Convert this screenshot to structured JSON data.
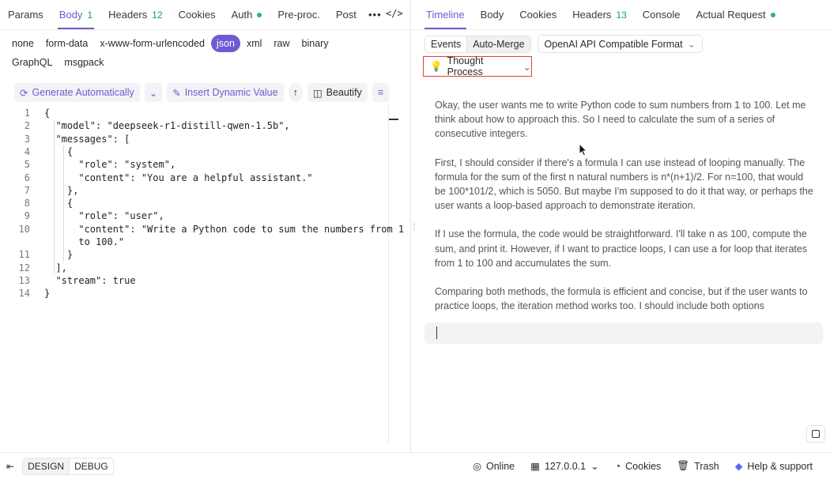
{
  "left_tabs": [
    {
      "label": "Params"
    },
    {
      "label": "Body",
      "badge": "1",
      "active": true
    },
    {
      "label": "Headers",
      "badge": "12"
    },
    {
      "label": "Cookies"
    },
    {
      "label": "Auth",
      "dot": true
    },
    {
      "label": "Pre-proc."
    },
    {
      "label": "Post"
    }
  ],
  "more_icon": "ellipsis-icon",
  "code_icon": "code-icon",
  "body_formats": {
    "row1": [
      "none",
      "form-data",
      "x-www-form-urlencoded",
      "json",
      "xml",
      "raw",
      "binary"
    ],
    "row2": [
      "GraphQL",
      "msgpack"
    ],
    "selected": "json"
  },
  "toolbar": {
    "generate": "Generate Automatically",
    "insert": "Insert Dynamic Value",
    "beautify": "Beautify"
  },
  "code_lines": [
    {
      "n": "1",
      "text": "{"
    },
    {
      "n": "2",
      "text": "  \"model\": \"deepseek-r1-distill-qwen-1.5b\","
    },
    {
      "n": "3",
      "text": "  \"messages\": ["
    },
    {
      "n": "4",
      "text": "    {"
    },
    {
      "n": "5",
      "text": "      \"role\": \"system\","
    },
    {
      "n": "6",
      "text": "      \"content\": \"You are a helpful assistant.\""
    },
    {
      "n": "7",
      "text": "    },"
    },
    {
      "n": "8",
      "text": "    {"
    },
    {
      "n": "9",
      "text": "      \"role\": \"user\","
    },
    {
      "n": "10",
      "text": "      \"content\": \"Write a Python code to sum the numbers from 1"
    },
    {
      "n": "",
      "text": "      to 100.\""
    },
    {
      "n": "11",
      "text": "    }"
    },
    {
      "n": "12",
      "text": "  ],"
    },
    {
      "n": "13",
      "text": "  \"stream\": true"
    },
    {
      "n": "14",
      "text": "}"
    }
  ],
  "right_tabs": [
    {
      "label": "Timeline",
      "active": true
    },
    {
      "label": "Body"
    },
    {
      "label": "Cookies"
    },
    {
      "label": "Headers",
      "badge": "13"
    },
    {
      "label": "Console"
    },
    {
      "label": "Actual Request",
      "dot": true
    }
  ],
  "response_toolbar": {
    "events": "Events",
    "auto_merge": "Auto-Merge",
    "format": "OpenAI API Compatible Format"
  },
  "thought_process": "Thought Process",
  "reasoning": [
    "Okay, the user wants me to write Python code to sum numbers from 1 to 100. Let me think about how to approach this. So I need to calculate the sum of a series of consecutive integers.",
    "First, I should consider if there's a formula I can use instead of looping manually. The formula for the sum of the first n natural numbers is n*(n+1)/2. For n=100, that would be 100*101/2, which is 5050. But maybe I'm supposed to do it that way, or perhaps the user wants a loop-based approach to demonstrate iteration.",
    "If I use the formula, the code would be straightforward. I'll take n as 100, compute the sum, and print it. However, if I want to practice loops, I can use a for loop that iterates from 1 to 100 and accumulates the sum.",
    "Comparing both methods, the formula is efficient and concise, but if the user wants to practice loops, the iteration method works too. I should include both options"
  ],
  "status_bar": {
    "design": "DESIGN",
    "debug": "DEBUG",
    "online": "Online",
    "host": "127.0.0.1",
    "cookies": "Cookies",
    "trash": "Trash",
    "help": "Help & support"
  },
  "colors": {
    "accent": "#6d5cd1",
    "success": "#2bb673",
    "highlight_border": "#e0403a"
  }
}
